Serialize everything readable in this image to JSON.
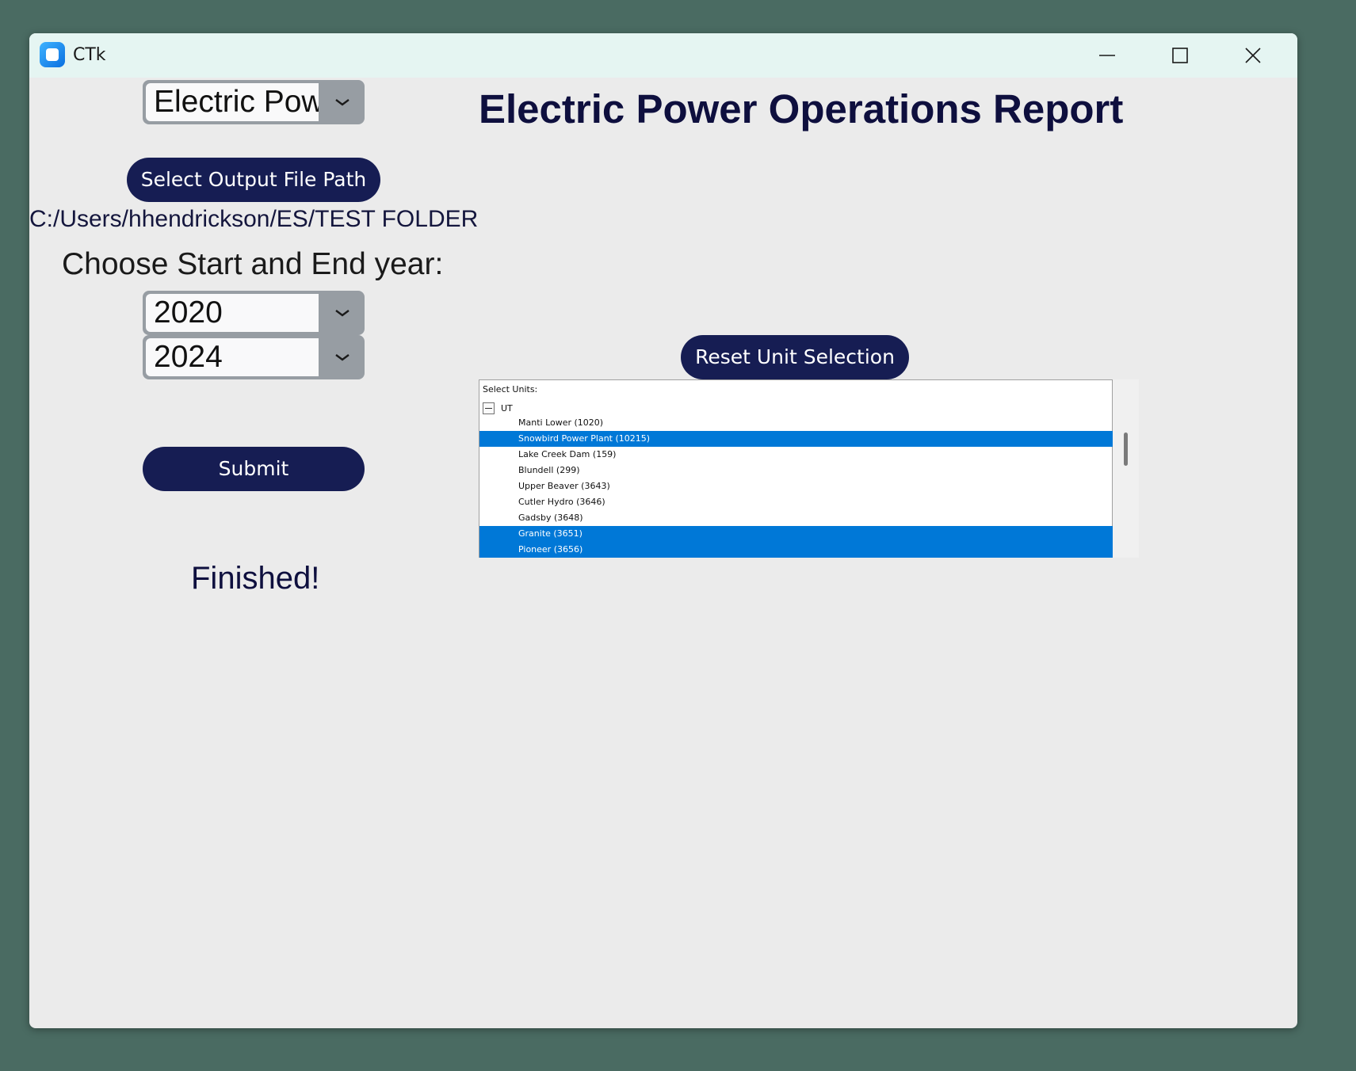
{
  "window": {
    "title": "CTk"
  },
  "report_select": {
    "value": "Electric Power Operations Report"
  },
  "output_path_button": {
    "label": "Select Output File Path"
  },
  "output_path": "C:/Users/hhendrickson/ES/TEST FOLDER",
  "main_heading": "Electric Power Operations Report",
  "year_section": {
    "label": "Choose Start and End year:",
    "start_year": "2020",
    "end_year": "2024"
  },
  "submit_button": {
    "label": "Submit"
  },
  "status": "Finished!",
  "reset_button": {
    "label": "Reset Unit Selection"
  },
  "units_tree": {
    "header": "Select Units:",
    "root": "UT",
    "items": [
      {
        "label": "Manti Lower (1020)",
        "selected": false
      },
      {
        "label": "Snowbird Power Plant (10215)",
        "selected": true
      },
      {
        "label": "Lake Creek Dam (159)",
        "selected": false
      },
      {
        "label": "Blundell (299)",
        "selected": false
      },
      {
        "label": "Upper Beaver (3643)",
        "selected": false
      },
      {
        "label": "Cutler Hydro (3646)",
        "selected": false
      },
      {
        "label": "Gadsby (3648)",
        "selected": false
      },
      {
        "label": "Granite (3651)",
        "selected": true
      },
      {
        "label": "Pioneer (3656)",
        "selected": true
      }
    ]
  },
  "colors": {
    "accent_button": "#161d53",
    "selection": "#0078d7",
    "titlebar": "#e5f5f2",
    "window_bg": "#ebebeb",
    "desktop": "#4a6b62"
  },
  "icons": {
    "app": "ctk-app-icon",
    "minimize": "minimize-icon",
    "maximize": "maximize-icon",
    "close": "close-icon",
    "dropdown": "chevron-down-icon",
    "collapse": "collapse-minus-icon"
  }
}
